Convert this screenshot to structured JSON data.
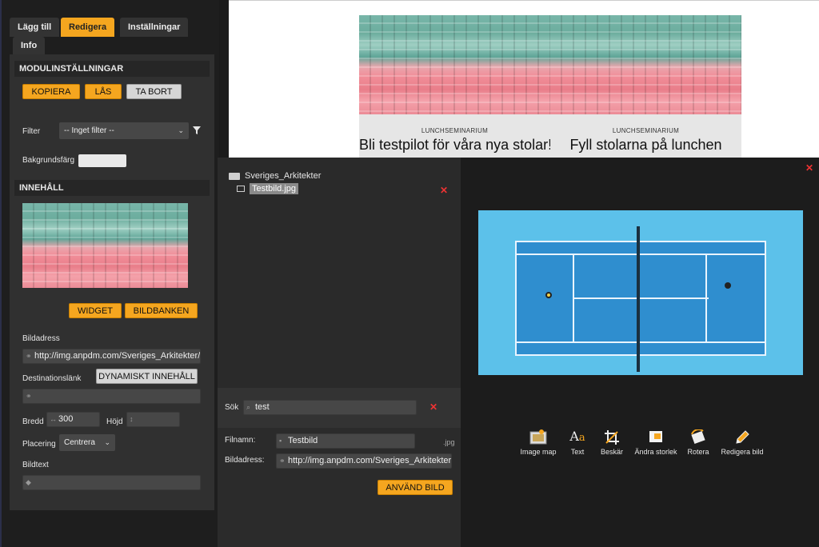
{
  "tabs": [
    "Lägg till",
    "Redigera",
    "Inställningar",
    "Info"
  ],
  "sections": {
    "module_settings": "MODULINSTÄLLNINGAR",
    "content": "INNEHÅLL"
  },
  "module_buttons": {
    "copy": "KOPIERA",
    "lock": "LÅS",
    "delete": "TA BORT"
  },
  "filter": {
    "label": "Filter",
    "value": "-- Inget filter --"
  },
  "background": {
    "label": "Bakgrundsfärg",
    "color": "#e9e9e9"
  },
  "content_buttons": {
    "widget": "WIDGET",
    "image_bank": "BILDBANKEN"
  },
  "image_address": {
    "label": "Bildadress",
    "value": "http://img.anpdm.com/Sveriges_Arkitekter/S"
  },
  "destination": {
    "label": "Destinationslänk",
    "dynamic_button": "DYNAMISKT INNEHÅLL",
    "value": ""
  },
  "width": {
    "label": "Bredd",
    "value": "300"
  },
  "height": {
    "label": "Höjd",
    "value": ""
  },
  "placement": {
    "label": "Placering",
    "value": "Centrera"
  },
  "alt_text": {
    "label": "Bildtext",
    "value": ""
  },
  "preview": {
    "cards": [
      {
        "kicker": "LUNCHSEMINARIUM",
        "title": "Bli testpilot för våra nya stolar!"
      },
      {
        "kicker": "LUNCHSEMINARIUM",
        "title": "Fyll stolarna på lunchen"
      }
    ]
  },
  "filebrowser": {
    "folder": "Sveriges_Arkitekter",
    "file": "Testbild.jpg",
    "search_label": "Sök",
    "search_value": "test",
    "filename_label": "Filnamn:",
    "filename_value": "Testbild",
    "filename_ext": ".jpg",
    "address_label": "Bildadress:",
    "address_value": "http://img.anpdm.com/Sveriges_Arkitekter/Te",
    "use_button": "ANVÄND BILD"
  },
  "image_tools": [
    {
      "label": "Image map",
      "icon": "image-map-icon"
    },
    {
      "label": "Text",
      "icon": "text-icon"
    },
    {
      "label": "Beskär",
      "icon": "crop-icon"
    },
    {
      "label": "Ändra storlek",
      "icon": "resize-icon"
    },
    {
      "label": "Rotera",
      "icon": "rotate-icon"
    },
    {
      "label": "Redigera bild",
      "icon": "edit-pencil-icon"
    }
  ],
  "colors": {
    "accent": "#f5a61f",
    "court_surround": "#5cc1ea",
    "court": "#2f8ecf",
    "close_red": "#e33333"
  }
}
